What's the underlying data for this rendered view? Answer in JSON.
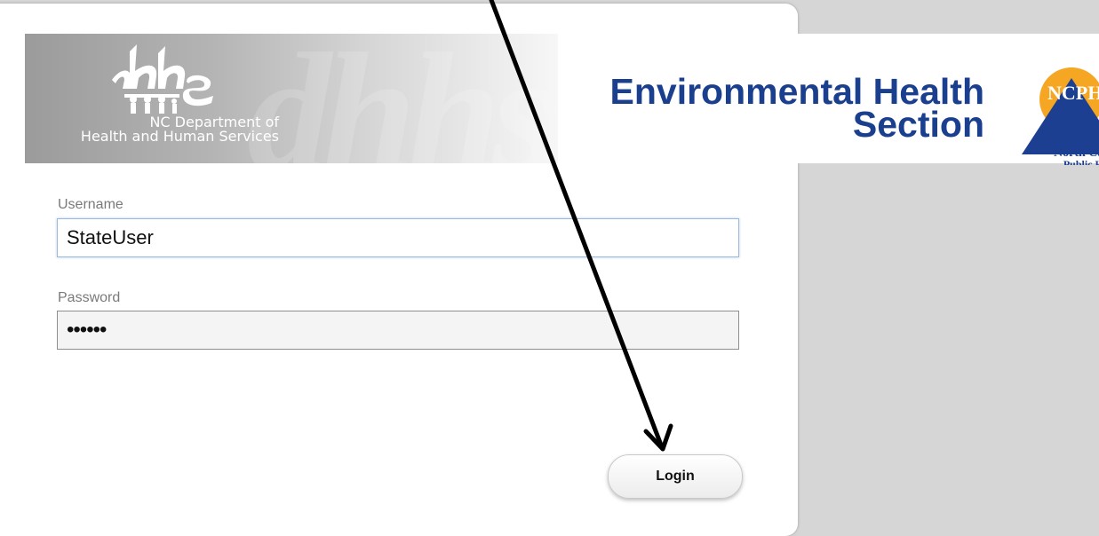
{
  "header": {
    "dept_line1": "NC Department of",
    "dept_line2": "Health and Human Services",
    "logo_text": "dhhs",
    "section_title_line1": "Environmental Health",
    "section_title_line2": "Section",
    "ncph_abbrev": "NCPH",
    "ncph_line1": "North Carolina",
    "ncph_line2": "Public Health"
  },
  "form": {
    "username_label": "Username",
    "username_value": "StateUser",
    "password_label": "Password",
    "password_value": "••••••",
    "login_label": "Login"
  },
  "colors": {
    "title_blue": "#1a3f8e",
    "ncph_orange": "#f5a623",
    "ncph_blue": "#1d3f92",
    "background": "#d6d6d6"
  }
}
